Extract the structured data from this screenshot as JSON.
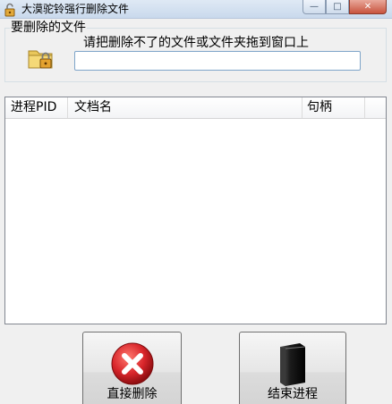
{
  "window": {
    "title": "大漠驼铃强行删除文件"
  },
  "caption": {
    "minimize": "—",
    "maximize": "□",
    "close": "✕"
  },
  "group": {
    "legend": "要删除的文件",
    "hint": "请把删除不了的文件或文件夹拖到窗口上",
    "input_value": ""
  },
  "list": {
    "columns": [
      "进程PID",
      "文档名",
      "句柄"
    ],
    "rows": []
  },
  "buttons": {
    "delete_label": "直接删除",
    "end_process_label": "结束进程"
  },
  "icons": {
    "app": "lock-icon",
    "folder": "folder-lock-icon",
    "delete": "red-x-icon",
    "end_process": "black-tower-icon"
  },
  "colors": {
    "delete_red": "#d9262b",
    "input_border": "#7fa5c9"
  }
}
